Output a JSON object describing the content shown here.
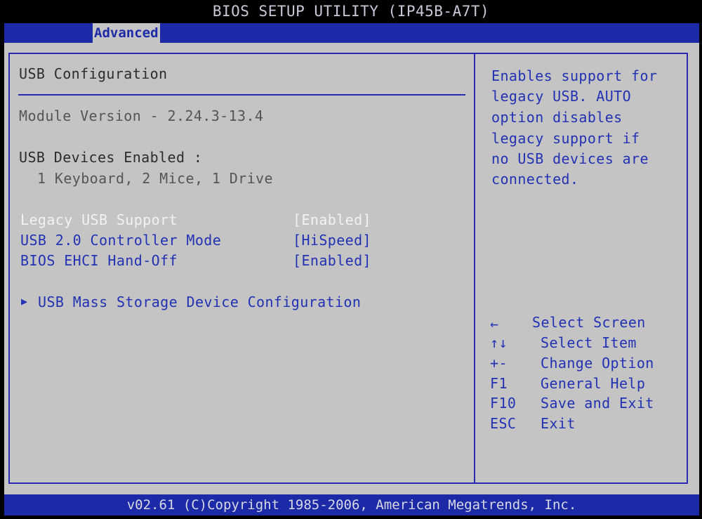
{
  "title": "BIOS SETUP UTILITY (IP45B-A7T)",
  "menu": {
    "active_tab": "Advanced"
  },
  "left_panel": {
    "heading": "USB Configuration",
    "module_version": "Module Version - 2.24.3-13.4",
    "devices_heading": "USB Devices Enabled :",
    "devices_value": "1 Keyboard, 2 Mice, 1 Drive",
    "settings": [
      {
        "label": "Legacy USB Support",
        "value": "[Enabled]",
        "selected": true
      },
      {
        "label": "USB 2.0 Controller Mode",
        "value": "[HiSpeed]",
        "selected": false
      },
      {
        "label": "BIOS EHCI Hand-Off",
        "value": "[Enabled]",
        "selected": false
      }
    ],
    "submenu": {
      "arrow": "▶",
      "label": "USB Mass Storage Device Configuration"
    }
  },
  "help_panel": {
    "lines": [
      "Enables support for",
      "legacy USB. AUTO",
      "option disables",
      "legacy support if",
      "no USB devices are",
      "connected."
    ]
  },
  "key_legend": [
    {
      "key": "←",
      "action": "Select Screen"
    },
    {
      "key": "↑↓",
      "action": "Select Item"
    },
    {
      "key": "+-",
      "action": "Change Option"
    },
    {
      "key": "F1",
      "action": "General Help"
    },
    {
      "key": "F10",
      "action": "Save and Exit"
    },
    {
      "key": "ESC",
      "action": "Exit"
    }
  ],
  "footer": "v02.61 (C)Copyright 1985-2006, American Megatrends, Inc.",
  "colors": {
    "background": "#c4c4c4",
    "bar_blue": "#1c2aa8",
    "text_blue": "#2232b2",
    "selected_text": "#f2f2f2"
  }
}
